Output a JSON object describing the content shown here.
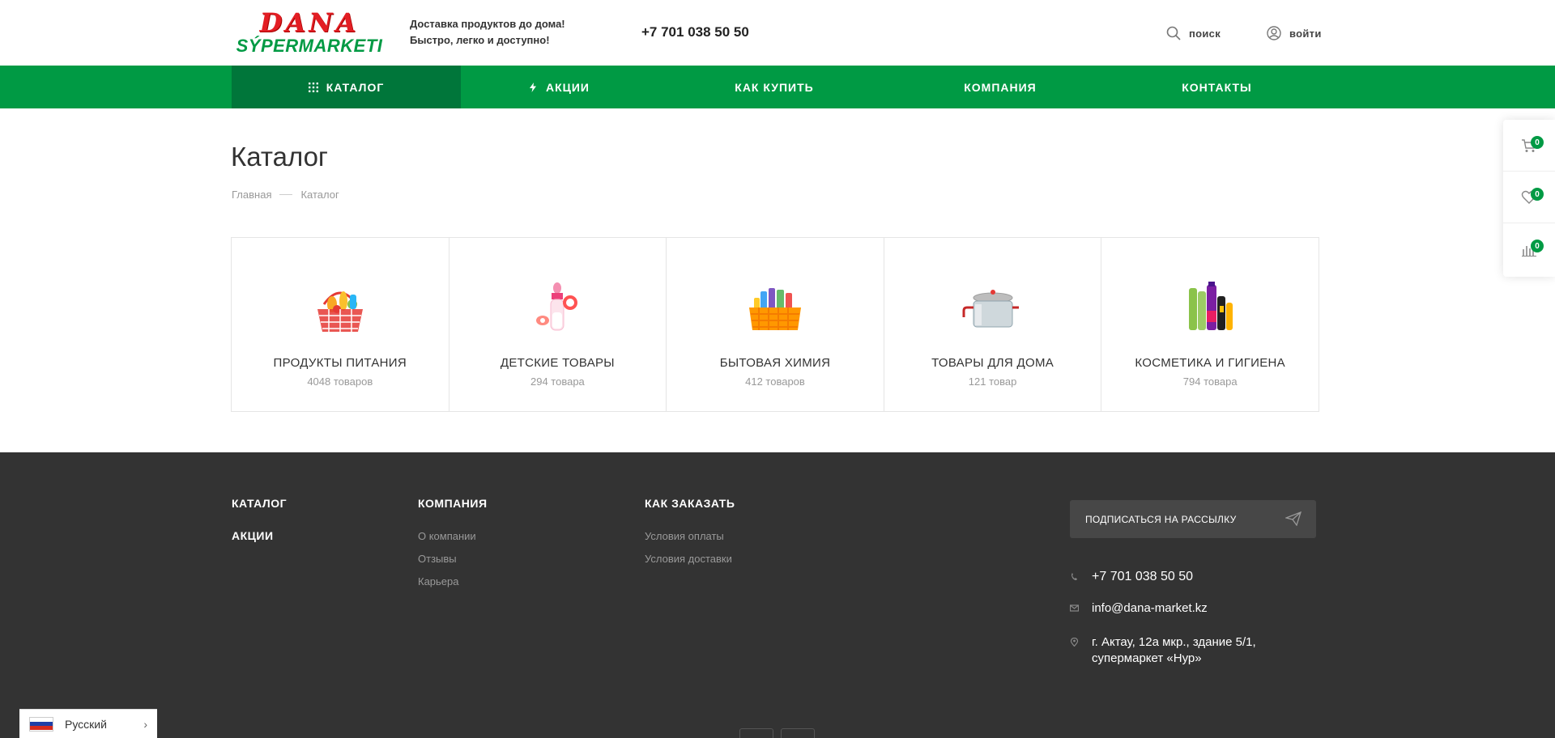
{
  "logo": {
    "top": "DANA",
    "bottom": "SÝPERMARKETI"
  },
  "header": {
    "tagline_line1": "Доставка продуктов до дома!",
    "tagline_line2": "Быстро, легко и доступно!",
    "phone": "+7 701 038 50 50",
    "search_label": "поиск",
    "login_label": "войти"
  },
  "nav": {
    "catalog": "КАТАЛОГ",
    "sales": "АКЦИИ",
    "how_to_buy": "КАК КУПИТЬ",
    "company": "КОМПАНИЯ",
    "contacts": "КОНТАКТЫ"
  },
  "page": {
    "title": "Каталог",
    "breadcrumb_home": "Главная",
    "breadcrumb_current": "Каталог"
  },
  "categories": [
    {
      "name": "ПРОДУКТЫ ПИТАНИЯ",
      "count": "4048 товаров",
      "icon": "grocery-basket-icon"
    },
    {
      "name": "ДЕТСКИЕ ТОВАРЫ",
      "count": "294 товара",
      "icon": "baby-bottle-icon"
    },
    {
      "name": "БЫТОВАЯ ХИМИЯ",
      "count": "412 товаров",
      "icon": "cleaning-supplies-icon"
    },
    {
      "name": "ТОВАРЫ ДЛЯ ДОМА",
      "count": "121 товар",
      "icon": "cooking-pot-icon"
    },
    {
      "name": "КОСМЕТИКА И ГИГИЕНА",
      "count": "794 товара",
      "icon": "cosmetics-icon"
    }
  ],
  "side_panel": {
    "cart_count": "0",
    "favorites_count": "0",
    "compare_count": "0"
  },
  "footer": {
    "col1_head1": "КАТАЛОГ",
    "col1_head2": "АКЦИИ",
    "col2_head": "КОМПАНИЯ",
    "col2_links": [
      "О компании",
      "Отзывы",
      "Карьера"
    ],
    "col3_head": "КАК ЗАКАЗАТЬ",
    "col3_links": [
      "Условия оплаты",
      "Условия доставки"
    ],
    "subscribe": "ПОДПИСАТЬСЯ НА РАССЫЛКУ",
    "phone": "+7 701 038 50 50",
    "email": "info@dana-market.kz",
    "address_line1": "г. Актау, 12а мкр., здание 5/1,",
    "address_line2": "супермаркет «Нур»"
  },
  "language": {
    "current": "Русский"
  },
  "colors": {
    "brand_green": "#009a44",
    "nav_active": "#00763a",
    "logo_red": "#e31e24",
    "footer_bg": "#333333"
  }
}
